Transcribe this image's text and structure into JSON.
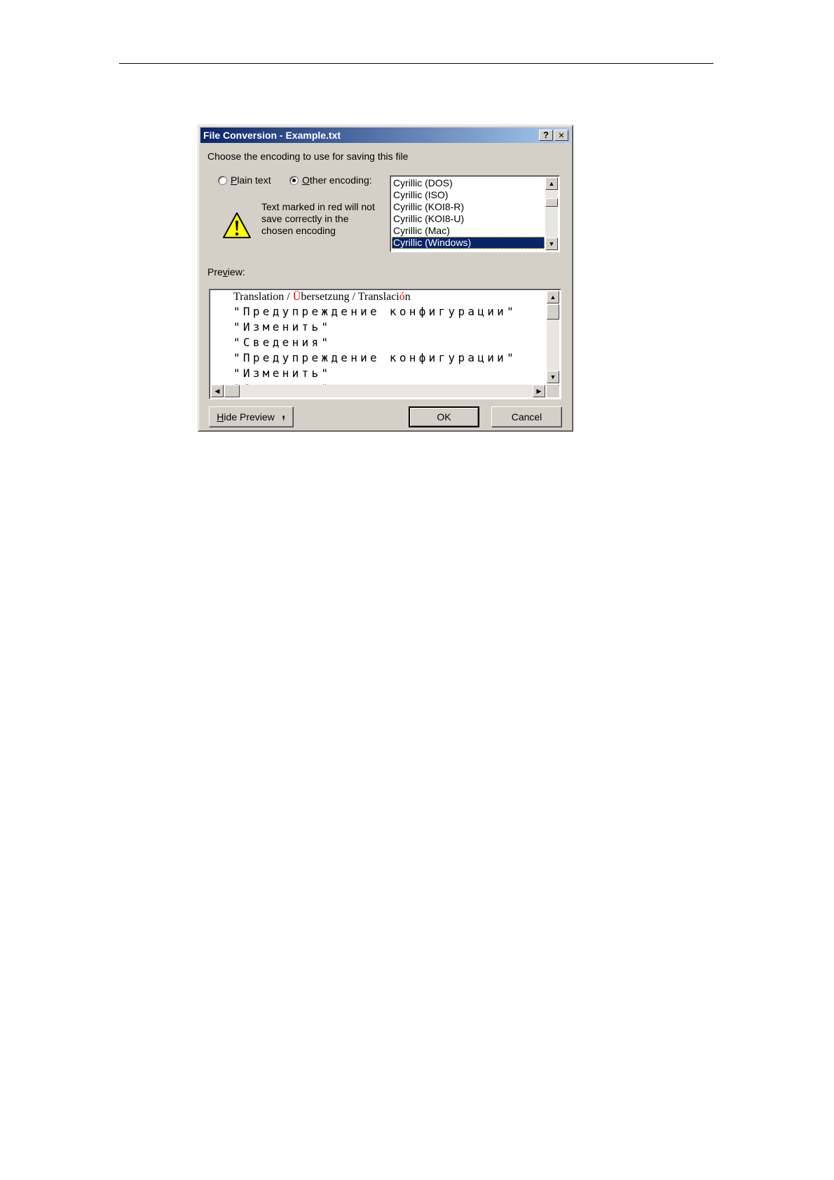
{
  "window": {
    "title": "File Conversion - Example.txt",
    "help_glyph": "?",
    "close_glyph": "✕"
  },
  "prompt": "Choose the encoding to use for saving this file",
  "options": {
    "plain_text": {
      "label_hot": "P",
      "label_rest": "lain text",
      "checked": false
    },
    "other_encoding": {
      "label_hot": "O",
      "label_rest": "ther encoding:",
      "checked": true
    }
  },
  "warning": {
    "icon": "warning-icon",
    "lines": [
      "Text marked in red will not",
      "save correctly in the",
      "chosen encoding"
    ]
  },
  "encodings": {
    "items": [
      "Cyrillic (DOS)",
      "Cyrillic (ISO)",
      "Cyrillic (KOI8-R)",
      "Cyrillic (KOI8-U)",
      "Cyrillic (Mac)",
      "Cyrillic (Windows)"
    ],
    "selected_index": 5
  },
  "preview": {
    "label_pre": "Pre",
    "label_hot": "v",
    "label_post": "iew:",
    "first_line": {
      "part1": "Translation / ",
      "red1": "Ü",
      "part2": "bersetzung / Translaci",
      "red2": "ó",
      "part3": "n"
    },
    "lines": [
      "\"Предупреждение конфигурации\"",
      "\"Изменить\"",
      "\"Сведения\"",
      "\"Предупреждение конфигурации\"",
      "\"Изменить\"",
      "\"Сведения\""
    ]
  },
  "buttons": {
    "hide_preview": {
      "hot": "H",
      "rest": "ide Preview",
      "glyph": "⯭"
    },
    "ok": "OK",
    "cancel": "Cancel"
  },
  "colors": {
    "titlebar_start": "#0a246a",
    "titlebar_end": "#a6caf0",
    "selection": "#0a246a",
    "invalid_text": "#e00000"
  }
}
